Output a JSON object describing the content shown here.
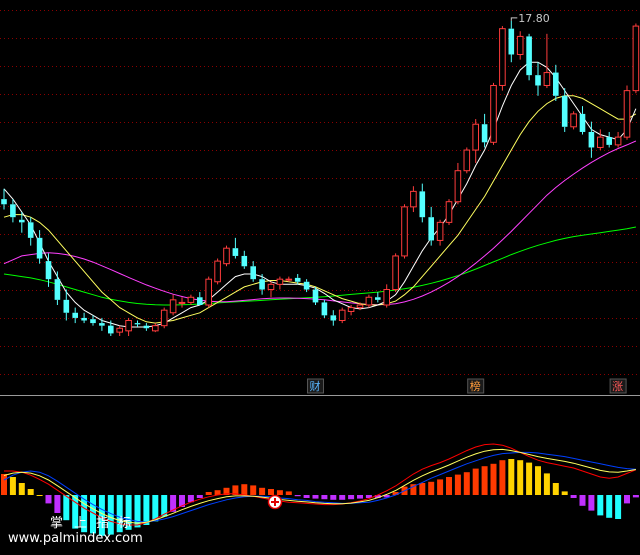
{
  "chart_data": {
    "type": "candlestick",
    "price_range": [
      5.6,
      18.3
    ],
    "high_label": "17.80",
    "event_tags": [
      {
        "label": "财",
        "index": 35,
        "color": "#59b7ff"
      },
      {
        "label": "榜",
        "index": 53,
        "color": "#ff9c3c"
      },
      {
        "label": "涨",
        "index": 69,
        "color": "#ff5a5a"
      }
    ],
    "candles": [
      [
        10.9,
        11.3,
        10.5,
        10.7
      ],
      [
        10.7,
        10.9,
        10.0,
        10.2
      ],
      [
        10.1,
        10.4,
        9.6,
        10.0
      ],
      [
        10.0,
        10.2,
        9.1,
        9.4
      ],
      [
        9.4,
        9.7,
        8.4,
        8.6
      ],
      [
        8.5,
        8.8,
        7.5,
        7.8
      ],
      [
        7.8,
        8.1,
        6.8,
        7.0
      ],
      [
        7.0,
        7.4,
        6.2,
        6.5
      ],
      [
        6.5,
        6.7,
        6.1,
        6.3
      ],
      [
        6.3,
        6.5,
        6.1,
        6.2
      ],
      [
        6.25,
        6.4,
        6.0,
        6.1
      ],
      [
        6.1,
        6.3,
        5.8,
        6.0
      ],
      [
        6.0,
        6.2,
        5.6,
        5.7
      ],
      [
        5.75,
        6.0,
        5.6,
        5.9
      ],
      [
        5.8,
        6.3,
        5.6,
        6.2
      ],
      [
        6.1,
        6.2,
        5.95,
        6.05
      ],
      [
        6.0,
        6.1,
        5.8,
        5.9
      ],
      [
        5.8,
        6.1,
        5.75,
        6.0
      ],
      [
        6.0,
        6.7,
        5.9,
        6.6
      ],
      [
        6.5,
        7.2,
        6.4,
        7.0
      ],
      [
        6.9,
        7.1,
        6.7,
        6.9
      ],
      [
        6.9,
        7.2,
        6.8,
        7.1
      ],
      [
        7.1,
        7.3,
        6.8,
        6.8
      ],
      [
        6.8,
        7.9,
        6.7,
        7.8
      ],
      [
        7.7,
        8.6,
        7.6,
        8.5
      ],
      [
        8.4,
        9.1,
        8.3,
        9.0
      ],
      [
        9.0,
        9.4,
        8.6,
        8.7
      ],
      [
        8.7,
        8.9,
        8.2,
        8.3
      ],
      [
        8.3,
        8.5,
        7.7,
        7.8
      ],
      [
        7.8,
        8.0,
        7.2,
        7.4
      ],
      [
        7.4,
        7.7,
        7.1,
        7.6
      ],
      [
        7.6,
        7.9,
        7.4,
        7.8
      ],
      [
        7.8,
        7.9,
        7.7,
        7.8
      ],
      [
        7.85,
        8.0,
        7.6,
        7.7
      ],
      [
        7.7,
        7.8,
        7.3,
        7.4
      ],
      [
        7.4,
        7.5,
        6.8,
        6.9
      ],
      [
        6.9,
        7.0,
        6.3,
        6.4
      ],
      [
        6.4,
        6.6,
        6.0,
        6.2
      ],
      [
        6.2,
        6.7,
        6.1,
        6.6
      ],
      [
        6.55,
        6.8,
        6.4,
        6.7
      ],
      [
        6.7,
        6.9,
        6.6,
        6.8
      ],
      [
        6.8,
        7.2,
        6.7,
        7.1
      ],
      [
        7.1,
        7.3,
        6.9,
        7.0
      ],
      [
        6.8,
        7.6,
        6.7,
        7.4
      ],
      [
        7.4,
        8.8,
        7.3,
        8.7
      ],
      [
        8.7,
        10.7,
        8.6,
        10.6
      ],
      [
        10.6,
        11.4,
        10.4,
        11.2
      ],
      [
        11.2,
        11.5,
        10.0,
        10.2
      ],
      [
        10.2,
        10.6,
        9.1,
        9.3
      ],
      [
        9.3,
        10.1,
        9.1,
        10.0
      ],
      [
        10.0,
        10.9,
        9.9,
        10.8
      ],
      [
        10.8,
        12.3,
        10.7,
        12.0
      ],
      [
        12.0,
        12.9,
        11.9,
        12.8
      ],
      [
        12.8,
        14.0,
        12.3,
        13.8
      ],
      [
        13.8,
        14.2,
        12.9,
        13.1
      ],
      [
        13.1,
        15.4,
        13.0,
        15.3
      ],
      [
        15.3,
        17.6,
        15.1,
        17.5
      ],
      [
        17.5,
        17.8,
        16.2,
        16.5
      ],
      [
        16.5,
        17.4,
        16.3,
        17.2
      ],
      [
        17.2,
        17.3,
        15.5,
        15.7
      ],
      [
        15.7,
        16.2,
        14.9,
        15.3
      ],
      [
        15.3,
        17.3,
        15.2,
        15.8
      ],
      [
        15.8,
        16.1,
        14.7,
        14.9
      ],
      [
        14.9,
        15.2,
        13.5,
        13.7
      ],
      [
        13.7,
        14.3,
        13.6,
        14.2
      ],
      [
        14.2,
        14.5,
        13.4,
        13.5
      ],
      [
        13.5,
        13.9,
        12.5,
        12.9
      ],
      [
        12.9,
        13.6,
        12.8,
        13.3
      ],
      [
        13.3,
        13.5,
        12.9,
        13.0
      ],
      [
        13.0,
        13.5,
        12.9,
        13.3
      ],
      [
        13.3,
        15.3,
        13.2,
        15.1
      ],
      [
        15.1,
        17.7,
        15.0,
        17.6
      ]
    ],
    "ma_short": [
      11.3,
      10.9,
      10.4,
      9.9,
      9.2,
      8.5,
      7.9,
      7.3,
      6.9,
      6.6,
      6.4,
      6.2,
      6.1,
      6.0,
      5.95,
      5.95,
      5.95,
      6.0,
      6.1,
      6.3,
      6.5,
      6.7,
      6.8,
      7.0,
      7.3,
      7.6,
      7.9,
      8.0,
      8.0,
      7.9,
      7.7,
      7.6,
      7.6,
      7.6,
      7.55,
      7.45,
      7.25,
      7.0,
      6.85,
      6.7,
      6.65,
      6.7,
      6.8,
      6.95,
      7.2,
      7.7,
      8.3,
      8.9,
      9.4,
      9.8,
      10.3,
      10.9,
      11.5,
      12.2,
      12.8,
      13.6,
      14.5,
      15.3,
      15.9,
      16.2,
      16.2,
      16.0,
      15.6,
      15.1,
      14.6,
      14.1,
      13.6,
      13.4,
      13.3,
      13.2,
      13.6,
      14.4
    ],
    "ma_mid": [
      10.2,
      10.3,
      10.3,
      10.2,
      10.0,
      9.7,
      9.3,
      8.9,
      8.5,
      8.1,
      7.7,
      7.3,
      7.0,
      6.7,
      6.5,
      6.3,
      6.15,
      6.1,
      6.15,
      6.2,
      6.3,
      6.4,
      6.5,
      6.7,
      6.9,
      7.1,
      7.3,
      7.5,
      7.6,
      7.7,
      7.75,
      7.75,
      7.7,
      7.65,
      7.6,
      7.5,
      7.35,
      7.2,
      7.05,
      6.95,
      6.85,
      6.8,
      6.8,
      6.85,
      6.95,
      7.2,
      7.5,
      7.9,
      8.3,
      8.7,
      9.1,
      9.5,
      10.0,
      10.5,
      11.0,
      11.6,
      12.2,
      12.8,
      13.4,
      13.9,
      14.3,
      14.6,
      14.8,
      14.9,
      14.9,
      14.8,
      14.6,
      14.4,
      14.2,
      14.0,
      14.0,
      14.2
    ],
    "ma_long": [
      8.4,
      8.55,
      8.7,
      8.75,
      8.8,
      8.82,
      8.8,
      8.75,
      8.68,
      8.58,
      8.46,
      8.32,
      8.17,
      8.02,
      7.87,
      7.72,
      7.58,
      7.45,
      7.33,
      7.22,
      7.13,
      7.05,
      6.99,
      6.95,
      6.93,
      6.93,
      6.95,
      6.98,
      7.01,
      7.04,
      7.06,
      7.07,
      7.07,
      7.06,
      7.05,
      7.03,
      7.0,
      6.96,
      6.92,
      6.88,
      6.85,
      6.82,
      6.81,
      6.82,
      6.85,
      6.92,
      7.02,
      7.15,
      7.3,
      7.48,
      7.68,
      7.9,
      8.15,
      8.42,
      8.7,
      9.0,
      9.32,
      9.65,
      10.0,
      10.35,
      10.7,
      11.05,
      11.35,
      11.62,
      11.87,
      12.1,
      12.32,
      12.52,
      12.7,
      12.86,
      13.0,
      13.15
    ],
    "ma_longer": [
      8.0,
      7.95,
      7.9,
      7.85,
      7.78,
      7.7,
      7.6,
      7.5,
      7.4,
      7.3,
      7.2,
      7.1,
      7.02,
      6.96,
      6.9,
      6.86,
      6.83,
      6.81,
      6.8,
      6.8,
      6.81,
      6.82,
      6.84,
      6.86,
      6.88,
      6.9,
      6.92,
      6.94,
      6.96,
      6.98,
      7.0,
      7.02,
      7.04,
      7.06,
      7.08,
      7.1,
      7.12,
      7.15,
      7.18,
      7.21,
      7.24,
      7.27,
      7.3,
      7.34,
      7.38,
      7.43,
      7.49,
      7.56,
      7.64,
      7.73,
      7.83,
      7.94,
      8.06,
      8.19,
      8.33,
      8.47,
      8.61,
      8.75,
      8.88,
      9.0,
      9.11,
      9.21,
      9.3,
      9.38,
      9.45,
      9.5,
      9.55,
      9.6,
      9.65,
      9.7,
      9.75,
      9.82
    ],
    "oscillator": {
      "range": [
        -1.0,
        1.0
      ],
      "line1": [
        0.4,
        0.4,
        0.38,
        0.33,
        0.26,
        0.18,
        0.08,
        -0.02,
        -0.12,
        -0.22,
        -0.3,
        -0.38,
        -0.44,
        -0.48,
        -0.5,
        -0.5,
        -0.46,
        -0.4,
        -0.32,
        -0.25,
        -0.18,
        -0.12,
        -0.07,
        -0.03,
        0.0,
        0.02,
        0.02,
        0.0,
        -0.02,
        -0.05,
        -0.08,
        -0.1,
        -0.12,
        -0.13,
        -0.14,
        -0.15,
        -0.16,
        -0.16,
        -0.15,
        -0.13,
        -0.1,
        -0.06,
        0.0,
        0.07,
        0.15,
        0.25,
        0.35,
        0.43,
        0.49,
        0.54,
        0.6,
        0.67,
        0.74,
        0.8,
        0.84,
        0.85,
        0.83,
        0.78,
        0.71,
        0.64,
        0.58,
        0.54,
        0.51,
        0.48,
        0.45,
        0.4,
        0.35,
        0.3,
        0.28,
        0.3,
        0.36,
        0.42
      ],
      "line2": [
        0.25,
        0.33,
        0.38,
        0.4,
        0.38,
        0.32,
        0.23,
        0.13,
        0.03,
        -0.07,
        -0.16,
        -0.24,
        -0.31,
        -0.37,
        -0.41,
        -0.44,
        -0.45,
        -0.43,
        -0.4,
        -0.36,
        -0.31,
        -0.26,
        -0.21,
        -0.16,
        -0.12,
        -0.08,
        -0.05,
        -0.03,
        -0.02,
        -0.02,
        -0.03,
        -0.05,
        -0.06,
        -0.08,
        -0.09,
        -0.11,
        -0.12,
        -0.13,
        -0.14,
        -0.14,
        -0.13,
        -0.12,
        -0.09,
        -0.05,
        0.0,
        0.07,
        0.14,
        0.21,
        0.28,
        0.34,
        0.4,
        0.46,
        0.52,
        0.57,
        0.62,
        0.66,
        0.69,
        0.7,
        0.71,
        0.71,
        0.7,
        0.68,
        0.66,
        0.64,
        0.61,
        0.58,
        0.55,
        0.52,
        0.49,
        0.46,
        0.44,
        0.43
      ],
      "bars": [
        0.35,
        0.3,
        0.2,
        0.1,
        0.0,
        -0.14,
        -0.3,
        -0.42,
        -0.56,
        -0.62,
        -0.64,
        -0.68,
        -0.66,
        -0.62,
        -0.58,
        -0.54,
        -0.5,
        -0.44,
        -0.36,
        -0.28,
        -0.2,
        -0.12,
        -0.05,
        0.05,
        0.08,
        0.12,
        0.16,
        0.18,
        0.16,
        0.12,
        0.1,
        0.08,
        0.06,
        -0.02,
        -0.05,
        -0.06,
        -0.07,
        -0.08,
        -0.08,
        -0.07,
        -0.06,
        -0.05,
        -0.05,
        -0.04,
        0.05,
        0.14,
        0.18,
        0.2,
        0.22,
        0.26,
        0.3,
        0.34,
        0.38,
        0.44,
        0.48,
        0.52,
        0.58,
        0.6,
        0.58,
        0.54,
        0.48,
        0.36,
        0.2,
        0.06,
        -0.05,
        -0.18,
        -0.26,
        -0.34,
        -0.38,
        -0.4,
        -0.14,
        -0.04
      ]
    }
  },
  "watermark": {
    "chars": [
      "掌",
      "上",
      "指",
      "标"
    ],
    "url": "www.palmindex.com"
  },
  "colors": {
    "background": "#000000",
    "up": "#ff3c3c",
    "down": "#54ffff",
    "ma_short": "#ffffff",
    "ma_mid": "#ffff60",
    "ma_long": "#ff40ff",
    "ma_longer": "#00ff00",
    "grid": "#8b0000",
    "osc_line1": "#ff0000",
    "osc_line2": "#0040ff",
    "bar_yellow": "#ffd300",
    "bar_red": "#ff3a00",
    "bar_purple": "#c030ff",
    "bar_cyan": "#20ffff"
  }
}
